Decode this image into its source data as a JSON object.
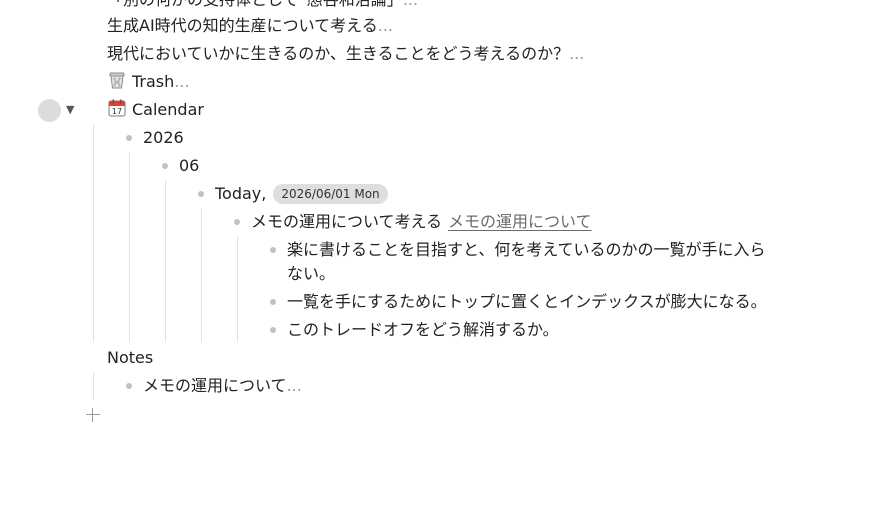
{
  "top_items": [
    {
      "text": "「別の何かの支持体として”態谷和治論」",
      "ellipsis": "..."
    },
    {
      "text": "生成AI時代の知的生産について考える",
      "ellipsis": "..."
    },
    {
      "text": "現代においていかに生きるのか、生きることをどう考えるのか？",
      "ellipsis": "..."
    }
  ],
  "trash": {
    "icon": "trash-icon",
    "label": "Trash",
    "ellipsis": "..."
  },
  "calendar": {
    "icon": "calendar-icon",
    "label": "Calendar",
    "year": "2026",
    "month": "06",
    "today_label": "Today,",
    "date_badge": "2026/06/01 Mon",
    "memo_text": "メモの運用について考える",
    "memo_link": "メモの運用について",
    "children": [
      {
        "line1": "楽に書けることを目指すと、何を考えているのかの一覧が手に入ら",
        "line2": "ない。"
      },
      {
        "line1": "一覧を手にするためにトップに置くとインデックスが膨大になる。"
      },
      {
        "line1": "このトレードオフをどう解消するか。"
      }
    ]
  },
  "notes": {
    "label": "Notes",
    "child": "メモの運用について",
    "ellipsis": "..."
  },
  "add_button": {
    "icon": "plus-icon"
  }
}
